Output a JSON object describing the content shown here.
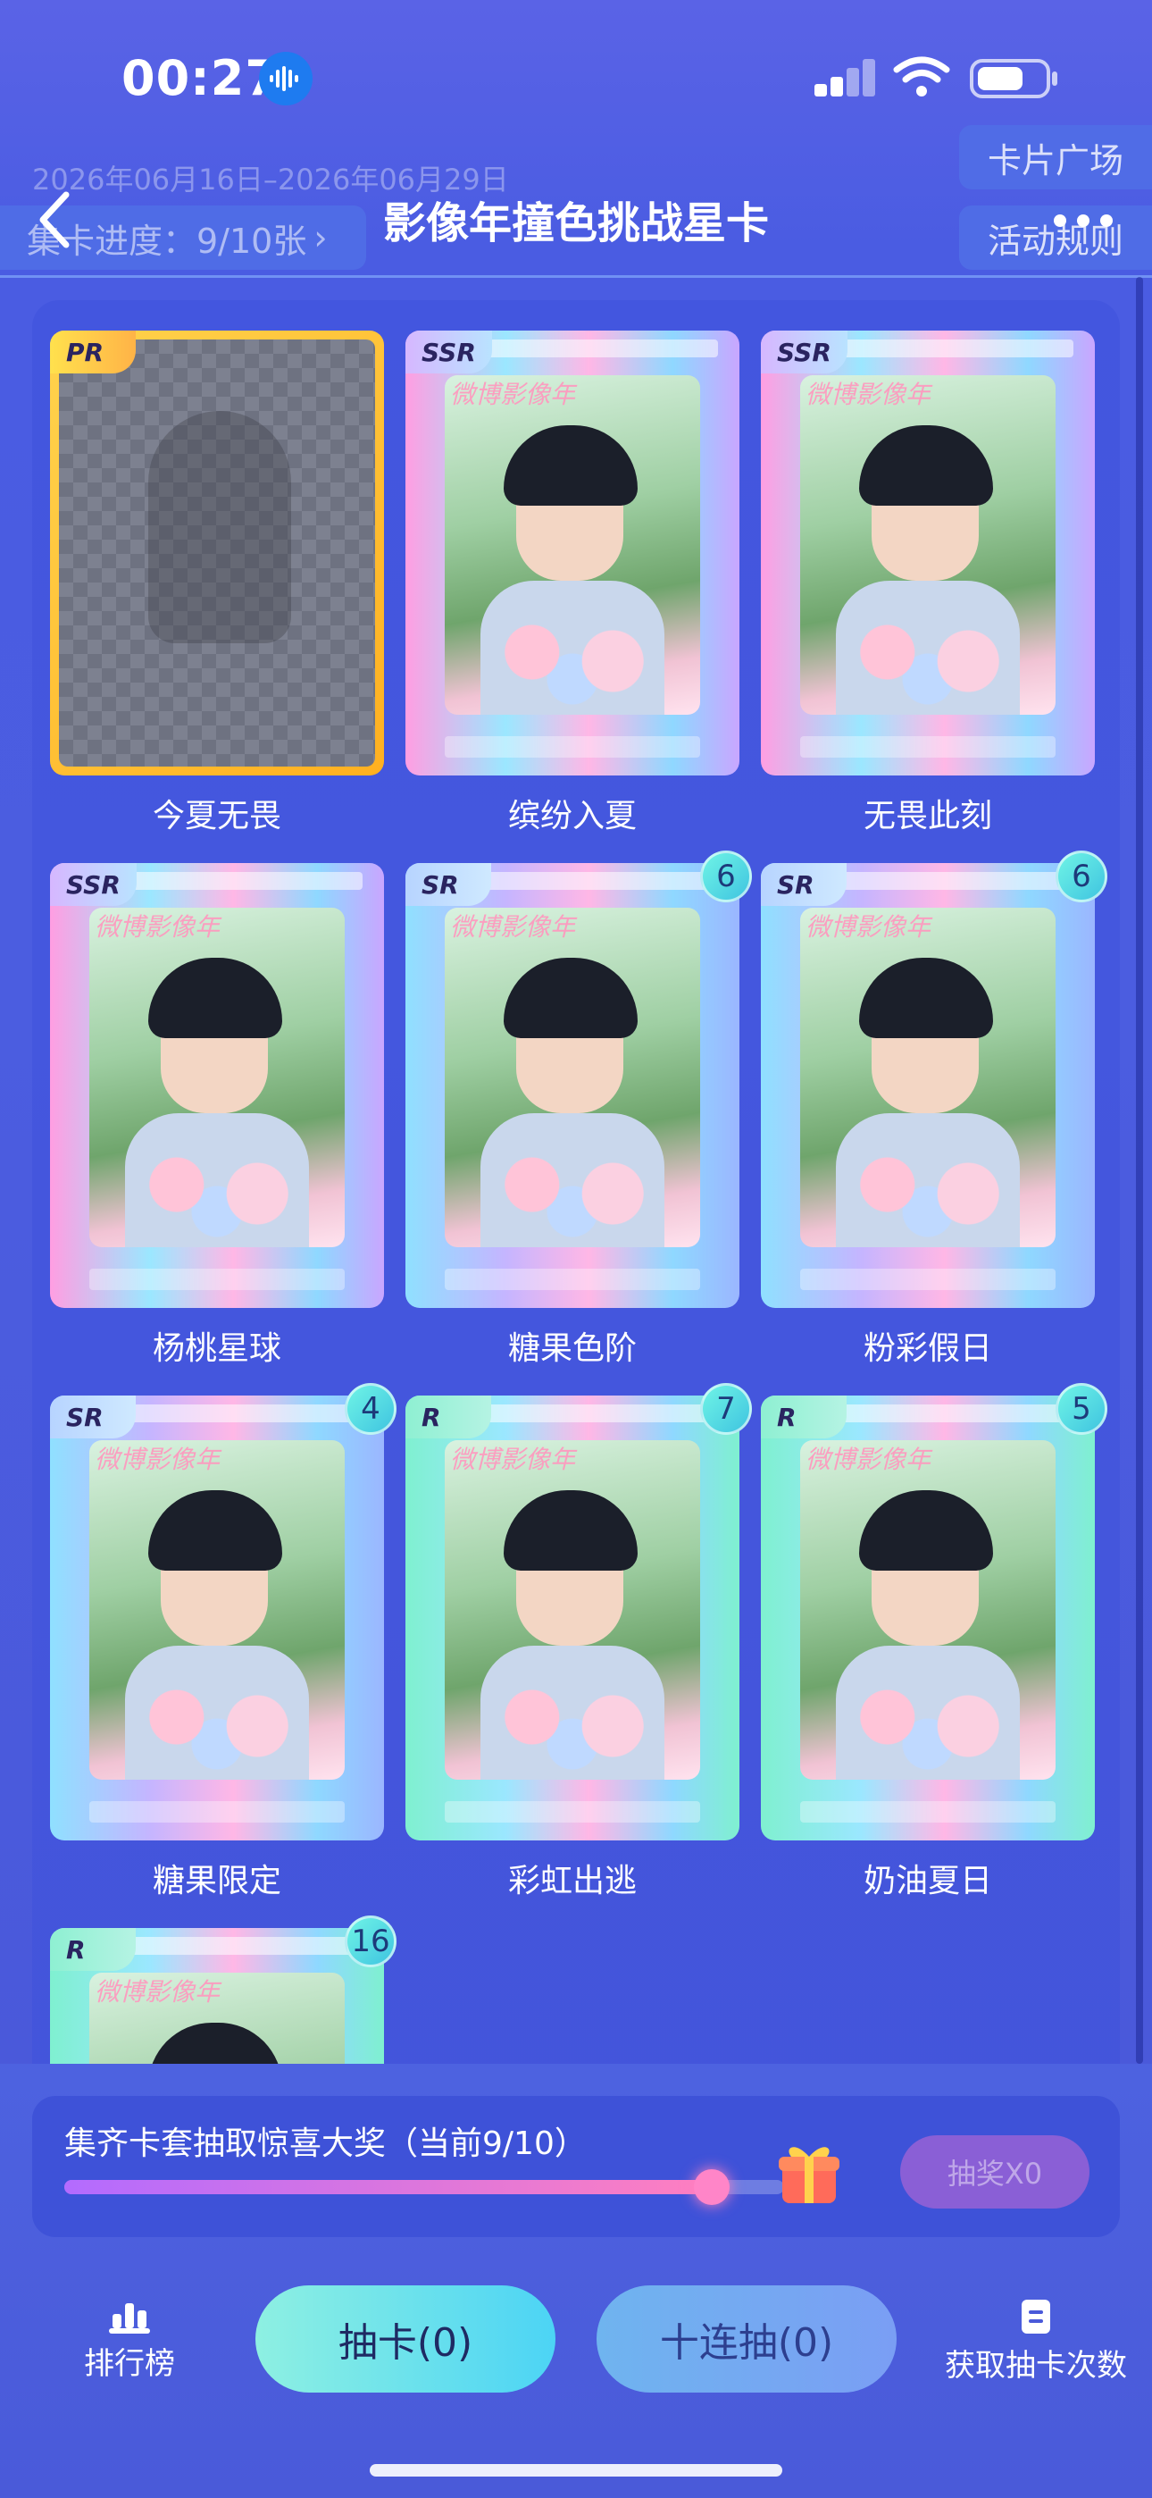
{
  "status_bar": {
    "time": "00:27"
  },
  "header": {
    "date_range": "2026年06月16日–2026年06月29日",
    "title": "影像年撞色挑战星卡",
    "progress": "集卡进度：9/10张",
    "progress_chevron": "›",
    "card_plaza": "卡片广场",
    "rules": "活动规则"
  },
  "cards": [
    {
      "name": "今夏无畏",
      "rarity": "PR",
      "count": null,
      "locked": true
    },
    {
      "name": "缤纷入夏",
      "rarity": "SSR",
      "count": null,
      "locked": false
    },
    {
      "name": "无畏此刻",
      "rarity": "SSR",
      "count": null,
      "locked": false
    },
    {
      "name": "杨桃星球",
      "rarity": "SSR",
      "count": null,
      "locked": false
    },
    {
      "name": "糖果色阶",
      "rarity": "SR",
      "count": "6",
      "locked": false
    },
    {
      "name": "粉彩假日",
      "rarity": "SR",
      "count": "6",
      "locked": false
    },
    {
      "name": "糖果限定",
      "rarity": "SR",
      "count": "4",
      "locked": false
    },
    {
      "name": "彩虹出逃",
      "rarity": "R",
      "count": "7",
      "locked": false
    },
    {
      "name": "奶油夏日",
      "rarity": "R",
      "count": "5",
      "locked": false
    },
    {
      "name": "",
      "rarity": "R",
      "count": "16",
      "locked": false
    }
  ],
  "card_watermark": "微博影像年",
  "collect": {
    "text": "集齐卡套抽取惊喜大奖（当前9/10）",
    "progress": 0.9,
    "lottery_button": "抽奖X0"
  },
  "bottom_nav": {
    "rank": "排行榜",
    "draw_one": "抽卡(0)",
    "draw_ten": "十连抽(0)",
    "get_chances": "获取抽卡次数"
  }
}
